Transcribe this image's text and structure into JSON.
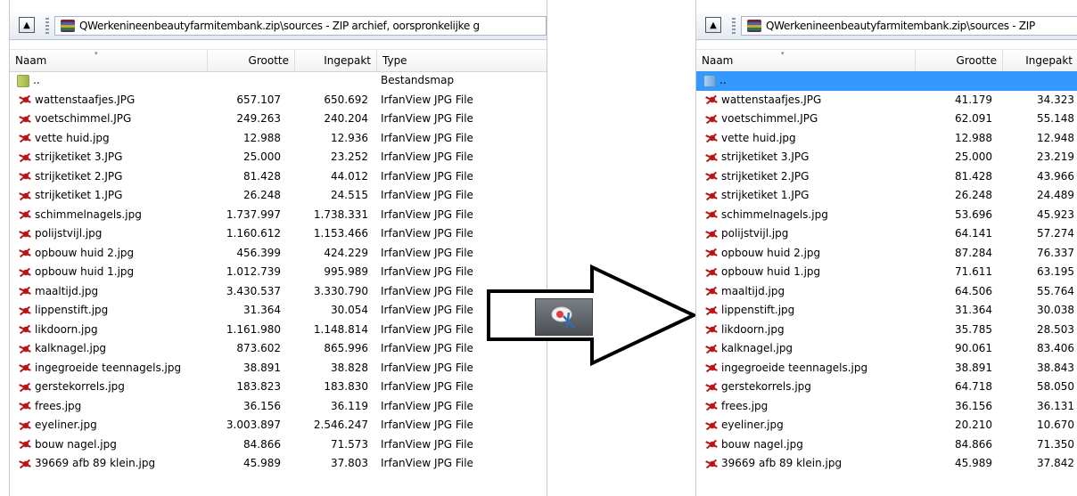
{
  "left": {
    "path": "QWerkenineenbeautyfarmitembank.zip\\sources - ZIP archief, oorspronkelijke g",
    "columns": {
      "name": "Naam",
      "size": "Grootte",
      "packed": "Ingepakt",
      "type": "Type"
    },
    "parent": {
      "name": "..",
      "type": "Bestandsmap"
    },
    "files": [
      {
        "name": "wattenstaafjes.JPG",
        "size": "657.107",
        "packed": "650.692",
        "type": "IrfanView JPG File"
      },
      {
        "name": "voetschimmel.JPG",
        "size": "249.263",
        "packed": "240.204",
        "type": "IrfanView JPG File"
      },
      {
        "name": "vette huid.jpg",
        "size": "12.988",
        "packed": "12.936",
        "type": "IrfanView JPG File"
      },
      {
        "name": "strijketiket 3.JPG",
        "size": "25.000",
        "packed": "23.252",
        "type": "IrfanView JPG File"
      },
      {
        "name": "strijketiket 2.JPG",
        "size": "81.428",
        "packed": "44.012",
        "type": "IrfanView JPG File"
      },
      {
        "name": "strijketiket 1.JPG",
        "size": "26.248",
        "packed": "24.515",
        "type": "IrfanView JPG File"
      },
      {
        "name": "schimmelnagels.jpg",
        "size": "1.737.997",
        "packed": "1.738.331",
        "type": "IrfanView JPG File"
      },
      {
        "name": "polijstvijl.jpg",
        "size": "1.160.612",
        "packed": "1.153.466",
        "type": "IrfanView JPG File"
      },
      {
        "name": "opbouw huid 2.jpg",
        "size": "456.399",
        "packed": "424.229",
        "type": "IrfanView JPG File"
      },
      {
        "name": "opbouw huid 1.jpg",
        "size": "1.012.739",
        "packed": "995.989",
        "type": "IrfanView JPG File"
      },
      {
        "name": "maaltijd.jpg",
        "size": "3.430.537",
        "packed": "3.330.790",
        "type": "IrfanView JPG File"
      },
      {
        "name": "lippenstift.jpg",
        "size": "31.364",
        "packed": "30.054",
        "type": "IrfanView JPG File"
      },
      {
        "name": "likdoorn.jpg",
        "size": "1.161.980",
        "packed": "1.148.814",
        "type": "IrfanView JPG File"
      },
      {
        "name": "kalknagel.jpg",
        "size": "873.602",
        "packed": "865.996",
        "type": "IrfanView JPG File"
      },
      {
        "name": "ingegroeide teennagels.jpg",
        "size": "38.891",
        "packed": "38.828",
        "type": "IrfanView JPG File"
      },
      {
        "name": "gerstekorrels.jpg",
        "size": "183.823",
        "packed": "183.830",
        "type": "IrfanView JPG File"
      },
      {
        "name": "frees.jpg",
        "size": "36.156",
        "packed": "36.119",
        "type": "IrfanView JPG File"
      },
      {
        "name": "eyeliner.jpg",
        "size": "3.003.897",
        "packed": "2.546.247",
        "type": "IrfanView JPG File"
      },
      {
        "name": "bouw nagel.jpg",
        "size": "84.866",
        "packed": "71.573",
        "type": "IrfanView JPG File"
      },
      {
        "name": "39669 afb 89 klein.jpg",
        "size": "45.989",
        "packed": "37.803",
        "type": "IrfanView JPG File"
      }
    ]
  },
  "right": {
    "path": "QWerkenineenbeautyfarmitembank.zip\\sources - ZIP",
    "columns": {
      "name": "Naam",
      "size": "Grootte",
      "packed": "Ingepakt"
    },
    "parent": {
      "name": ".."
    },
    "files": [
      {
        "name": "wattenstaafjes.JPG",
        "size": "41.179",
        "packed": "34.323"
      },
      {
        "name": "voetschimmel.JPG",
        "size": "62.091",
        "packed": "55.148"
      },
      {
        "name": "vette huid.jpg",
        "size": "12.988",
        "packed": "12.948"
      },
      {
        "name": "strijketiket 3.JPG",
        "size": "25.000",
        "packed": "23.219"
      },
      {
        "name": "strijketiket 2.JPG",
        "size": "81.428",
        "packed": "43.966"
      },
      {
        "name": "strijketiket 1.JPG",
        "size": "26.248",
        "packed": "24.489"
      },
      {
        "name": "schimmelnagels.jpg",
        "size": "53.696",
        "packed": "45.923"
      },
      {
        "name": "polijstvijl.jpg",
        "size": "64.141",
        "packed": "57.274"
      },
      {
        "name": "opbouw huid 2.jpg",
        "size": "87.284",
        "packed": "76.337"
      },
      {
        "name": "opbouw huid 1.jpg",
        "size": "71.611",
        "packed": "63.195"
      },
      {
        "name": "maaltijd.jpg",
        "size": "64.506",
        "packed": "55.764"
      },
      {
        "name": "lippenstift.jpg",
        "size": "31.364",
        "packed": "30.038"
      },
      {
        "name": "likdoorn.jpg",
        "size": "35.785",
        "packed": "28.503"
      },
      {
        "name": "kalknagel.jpg",
        "size": "90.061",
        "packed": "83.406"
      },
      {
        "name": "ingegroeide teennagels.jpg",
        "size": "38.891",
        "packed": "38.843"
      },
      {
        "name": "gerstekorrels.jpg",
        "size": "64.718",
        "packed": "58.050"
      },
      {
        "name": "frees.jpg",
        "size": "36.156",
        "packed": "36.131"
      },
      {
        "name": "eyeliner.jpg",
        "size": "20.210",
        "packed": "10.670"
      },
      {
        "name": "bouw nagel.jpg",
        "size": "84.866",
        "packed": "71.350"
      },
      {
        "name": "39669 afb 89 klein.jpg",
        "size": "45.989",
        "packed": "37.842"
      }
    ]
  },
  "icons": {
    "up": "folder-up-icon",
    "archive": "zip-archive-icon",
    "file": "irfanview-jpg-icon",
    "folder": "folder-icon",
    "tool": "scissors-tool-icon"
  },
  "colors": {
    "selection": "#3399ff",
    "toolbar": "#e4eaf2"
  }
}
